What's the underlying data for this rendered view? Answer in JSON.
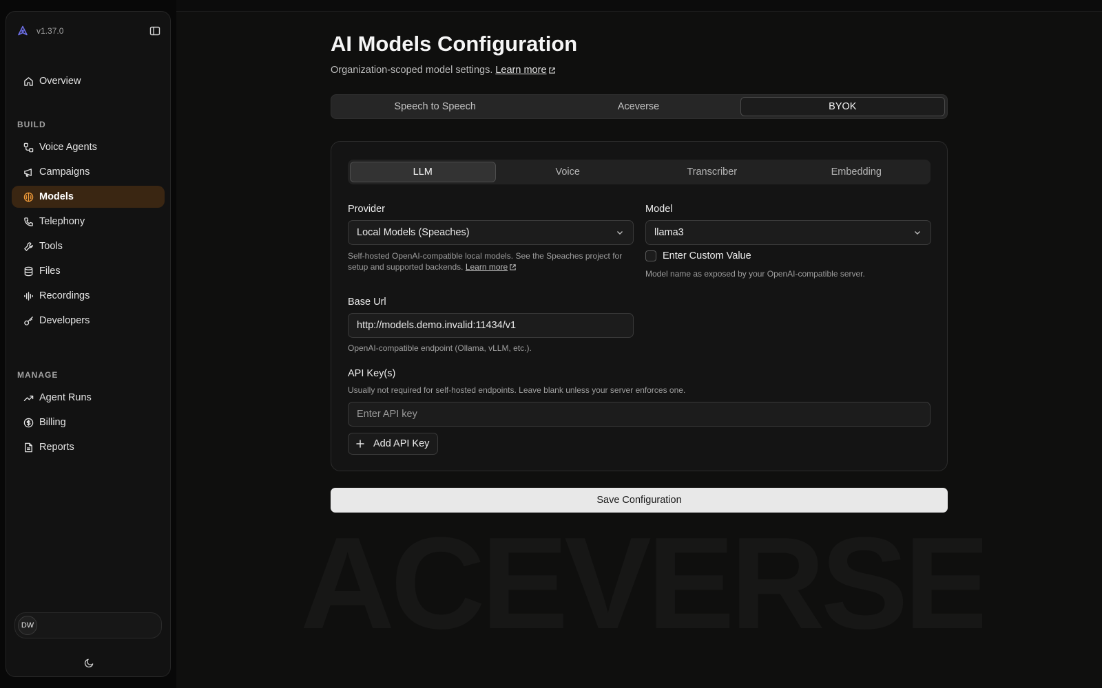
{
  "app": {
    "version": "v1.37.0",
    "watermark": "ACEVERSE"
  },
  "sidebar": {
    "top_items": [
      {
        "label": "Overview",
        "icon": "home-icon"
      }
    ],
    "sections": [
      {
        "label": "BUILD",
        "items": [
          {
            "label": "Voice Agents",
            "icon": "workflow-icon"
          },
          {
            "label": "Campaigns",
            "icon": "megaphone-icon"
          },
          {
            "label": "Models",
            "icon": "brain-icon",
            "active": true
          },
          {
            "label": "Telephony",
            "icon": "phone-icon"
          },
          {
            "label": "Tools",
            "icon": "wrench-icon"
          },
          {
            "label": "Files",
            "icon": "database-icon"
          },
          {
            "label": "Recordings",
            "icon": "audio-lines-icon"
          },
          {
            "label": "Developers",
            "icon": "key-icon"
          }
        ]
      },
      {
        "label": "MANAGE",
        "items": [
          {
            "label": "Agent Runs",
            "icon": "trend-icon"
          },
          {
            "label": "Billing",
            "icon": "dollar-circle-icon"
          },
          {
            "label": "Reports",
            "icon": "file-text-icon"
          }
        ]
      }
    ],
    "user": {
      "initials": "DW"
    },
    "accent": "#f59e3a"
  },
  "page": {
    "title": "AI Models Configuration",
    "subtitle": "Organization-scoped model settings.",
    "learn_more": "Learn more"
  },
  "mode_tabs": {
    "items": [
      "Speech to Speech",
      "Aceverse",
      "BYOK"
    ],
    "active": "BYOK"
  },
  "config_tabs": {
    "items": [
      "LLM",
      "Voice",
      "Transcriber",
      "Embedding"
    ],
    "active": "LLM"
  },
  "form": {
    "provider": {
      "label": "Provider",
      "value": "Local Models (Speaches)",
      "help": "Self-hosted OpenAI-compatible local models. See the Speaches project for setup and supported backends.",
      "help_link": "Learn more"
    },
    "model": {
      "label": "Model",
      "value": "llama3",
      "custom_label": "Enter Custom Value",
      "custom_checked": false,
      "help": "Model name as exposed by your OpenAI-compatible server."
    },
    "base_url": {
      "label": "Base Url",
      "value": "http://models.demo.invalid:11434/v1",
      "help": "OpenAI-compatible endpoint (Ollama, vLLM, etc.)."
    },
    "api_keys": {
      "label": "API Key(s)",
      "help": "Usually not required for self-hosted endpoints. Leave blank unless your server enforces one.",
      "placeholder": "Enter API key",
      "add_label": "Add API Key"
    }
  },
  "save_label": "Save Configuration"
}
